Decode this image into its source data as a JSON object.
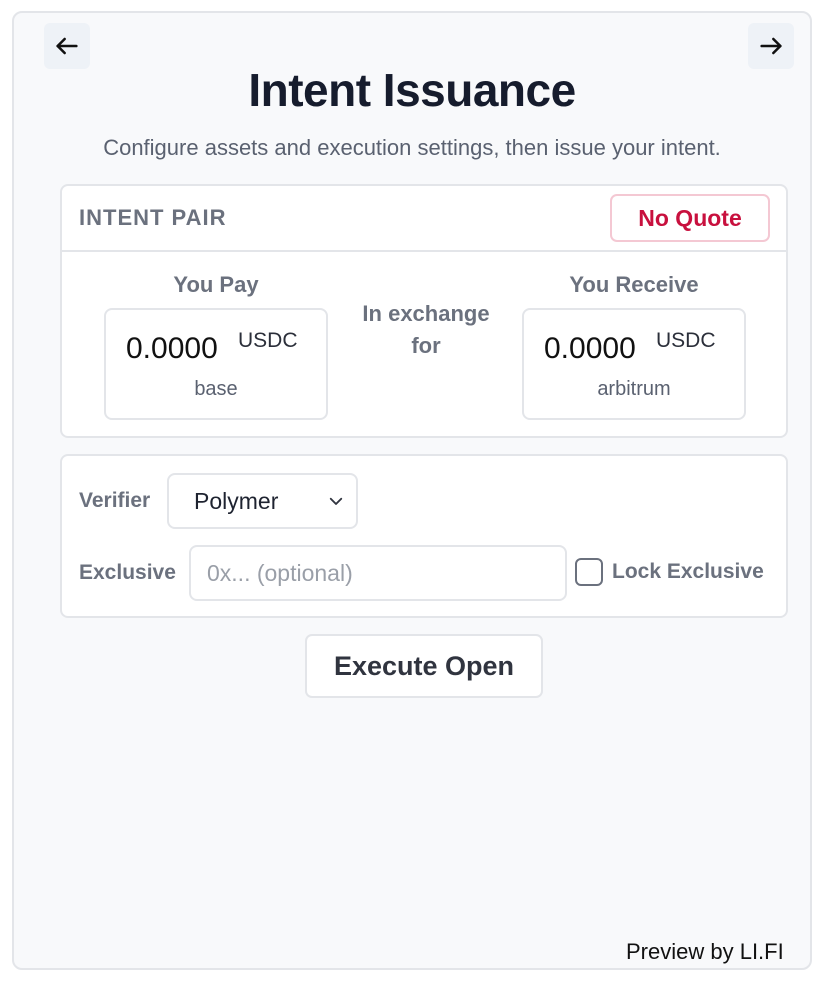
{
  "header": {
    "title": "Intent Issuance",
    "subtitle": "Configure assets and execution settings, then issue your intent.",
    "back_icon": "arrow-left-icon",
    "forward_icon": "arrow-right-icon"
  },
  "pair": {
    "title": "INTENT PAIR",
    "quote_status": "No Quote",
    "pay": {
      "label": "You Pay",
      "amount": "0.0000",
      "token": "USDC",
      "chain": "base"
    },
    "exchange_label": "In exchange for",
    "receive": {
      "label": "You Receive",
      "amount": "0.0000",
      "token": "USDC",
      "chain": "arbitrum"
    }
  },
  "settings": {
    "verifier_label": "Verifier",
    "verifier_value": "Polymer",
    "exclusive_label": "Exclusive",
    "exclusive_placeholder": "0x... (optional)",
    "exclusive_value": "",
    "lock_exclusive_label": "Lock Exclusive",
    "lock_exclusive_checked": false
  },
  "actions": {
    "execute_label": "Execute Open"
  },
  "footer": {
    "text": "Preview by LI.FI"
  },
  "colors": {
    "title": "#161c2d",
    "muted": "#6b717e",
    "badge_text": "#c8103e",
    "badge_border": "#f4c8d3",
    "border": "#e3e5e9",
    "background": "#f8f9fb"
  }
}
